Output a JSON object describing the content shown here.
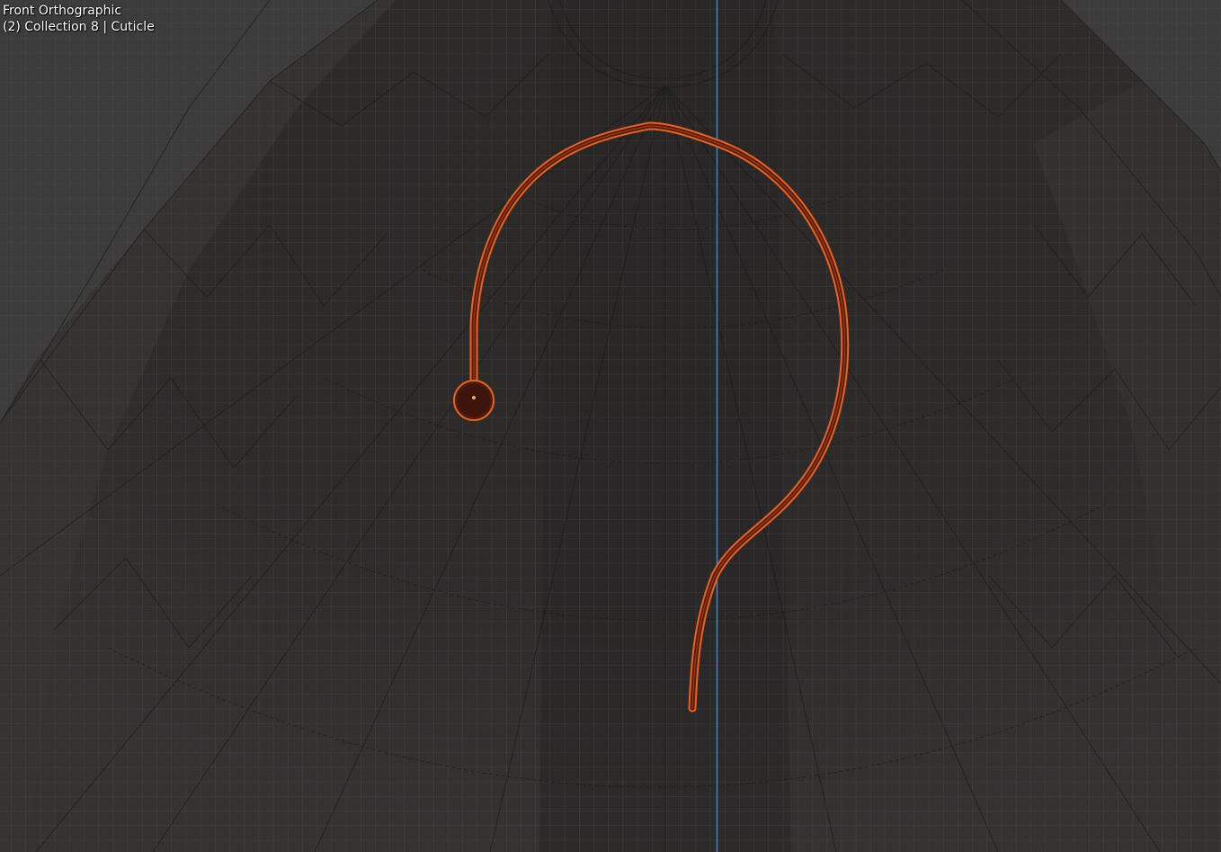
{
  "viewport": {
    "view_name": "Front Orthographic",
    "context_info": "(2) Collection 8 | Cuticle"
  },
  "colors": {
    "background": "#3b3b3b",
    "mesh_dark": "#2a2827",
    "grid_line": "#4a4a4a",
    "axis_z": "#3d7bd9",
    "selection_orange": "#e8641e",
    "curve_fill": "#4a1a0c"
  },
  "icons": {
    "origin_point": "object-origin-dot"
  }
}
